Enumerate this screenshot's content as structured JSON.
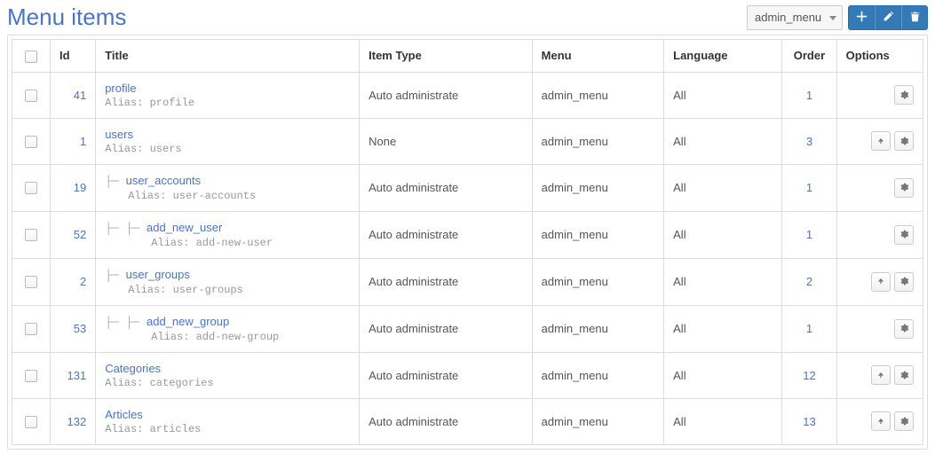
{
  "page": {
    "title": "Menu items"
  },
  "controls": {
    "selected_menu": "admin_menu"
  },
  "columns": {
    "checkbox": "",
    "id": "Id",
    "title": "Title",
    "item_type": "Item Type",
    "menu": "Menu",
    "language": "Language",
    "order": "Order",
    "options": "Options"
  },
  "alias_label": "Alias:",
  "icons": {
    "add": "add-icon",
    "edit": "edit-icon",
    "delete": "delete-icon",
    "gear": "gear-icon",
    "up": "arrow-up-icon"
  },
  "rows": [
    {
      "id": "41",
      "indent": 0,
      "title": "profile",
      "alias": "profile",
      "item_type": "Auto administrate",
      "menu": "admin_menu",
      "language": "All",
      "order": "1",
      "has_up": false
    },
    {
      "id": "1",
      "indent": 0,
      "title": "users",
      "alias": "users",
      "item_type": "None",
      "menu": "admin_menu",
      "language": "All",
      "order": "3",
      "has_up": true
    },
    {
      "id": "19",
      "indent": 1,
      "title": "user_accounts",
      "alias": "user-accounts",
      "item_type": "Auto administrate",
      "menu": "admin_menu",
      "language": "All",
      "order": "1",
      "has_up": false
    },
    {
      "id": "52",
      "indent": 2,
      "title": "add_new_user",
      "alias": "add-new-user",
      "item_type": "Auto administrate",
      "menu": "admin_menu",
      "language": "All",
      "order": "1",
      "has_up": false
    },
    {
      "id": "2",
      "indent": 1,
      "title": "user_groups",
      "alias": "user-groups",
      "item_type": "Auto administrate",
      "menu": "admin_menu",
      "language": "All",
      "order": "2",
      "has_up": true
    },
    {
      "id": "53",
      "indent": 2,
      "title": "add_new_group",
      "alias": "add-new-group",
      "item_type": "Auto administrate",
      "menu": "admin_menu",
      "language": "All",
      "order": "1",
      "has_up": false
    },
    {
      "id": "131",
      "indent": 0,
      "title": "Categories",
      "alias": "categories",
      "item_type": "Auto administrate",
      "menu": "admin_menu",
      "language": "All",
      "order": "12",
      "has_up": true
    },
    {
      "id": "132",
      "indent": 0,
      "title": "Articles",
      "alias": "articles",
      "item_type": "Auto administrate",
      "menu": "admin_menu",
      "language": "All",
      "order": "13",
      "has_up": true
    }
  ]
}
